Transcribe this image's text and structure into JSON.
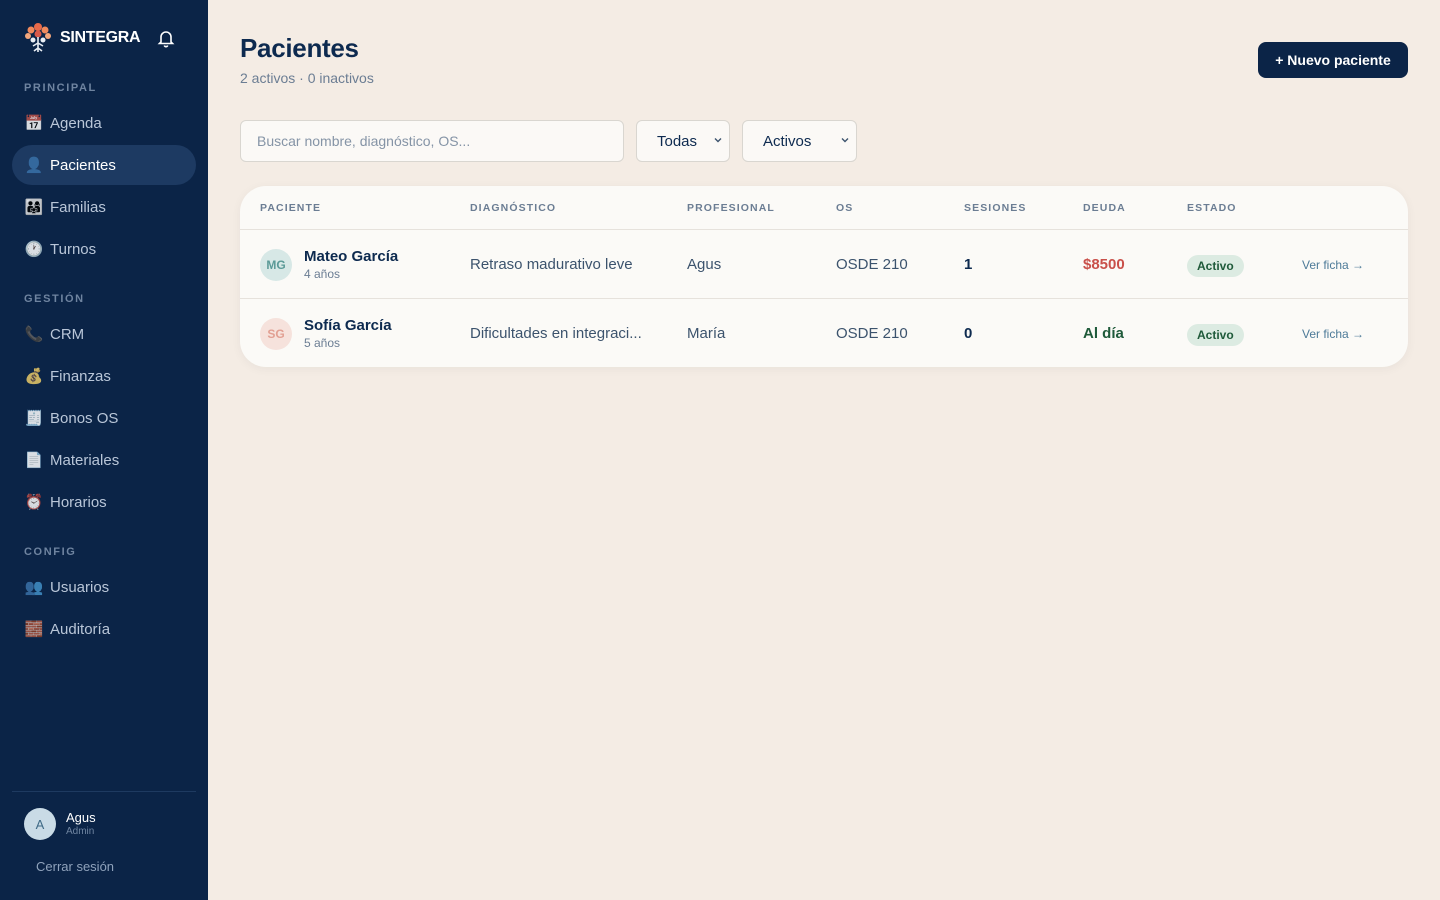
{
  "brand": {
    "name": "SINTEGRA"
  },
  "sidebar": {
    "sections": [
      {
        "title": "PRINCIPAL"
      },
      {
        "title": "GESTIÓN"
      },
      {
        "title": "CONFIG"
      }
    ],
    "items": [
      {
        "label": "Agenda",
        "icon": "📅"
      },
      {
        "label": "Pacientes",
        "icon": "👤"
      },
      {
        "label": "Familias",
        "icon": "👨‍👩‍👧"
      },
      {
        "label": "Turnos",
        "icon": "🕐"
      },
      {
        "label": "CRM",
        "icon": "📞"
      },
      {
        "label": "Finanzas",
        "icon": "💰"
      },
      {
        "label": "Bonos OS",
        "icon": "🧾"
      },
      {
        "label": "Materiales",
        "icon": "📄"
      },
      {
        "label": "Horarios",
        "icon": "⏰"
      },
      {
        "label": "Usuarios",
        "icon": "👥"
      },
      {
        "label": "Auditoría",
        "icon": "🧱"
      }
    ],
    "user": {
      "initial": "A",
      "name": "Agus",
      "role": "Admin"
    },
    "logout_label": "Cerrar sesión"
  },
  "header": {
    "title": "Pacientes",
    "subtitle": "2 activos · 0 inactivos",
    "new_button": "+ Nuevo paciente"
  },
  "filters": {
    "search_placeholder": "Buscar nombre, diagnóstico, OS...",
    "os_filter": "Todas",
    "status_filter": "Activos"
  },
  "table": {
    "columns": [
      "PACIENTE",
      "DIAGNÓSTICO",
      "PROFESIONAL",
      "OS",
      "SESIONES",
      "DEUDA",
      "ESTADO"
    ],
    "rows": [
      {
        "initials": "MG",
        "name": "Mateo García",
        "age": "4 años",
        "diagnosis": "Retraso madurativo leve",
        "professional": "Agus",
        "os": "OSDE 210",
        "sessions": "1",
        "debt": "$8500",
        "debt_color": "#c9504a",
        "status": "Activo",
        "action": "Ver ficha →",
        "avatar_bg": "#d7e8e6",
        "avatar_fg": "#5b9a97"
      },
      {
        "initials": "SG",
        "name": "Sofía García",
        "age": "5 años",
        "diagnosis": "Dificultades en integraci...",
        "professional": "María",
        "os": "OSDE 210",
        "sessions": "0",
        "debt": "Al día",
        "debt_color": "#1f5a3a",
        "status": "Activo",
        "action": "Ver ficha →",
        "avatar_bg": "#f6e2dc",
        "avatar_fg": "#e2a093"
      }
    ]
  }
}
